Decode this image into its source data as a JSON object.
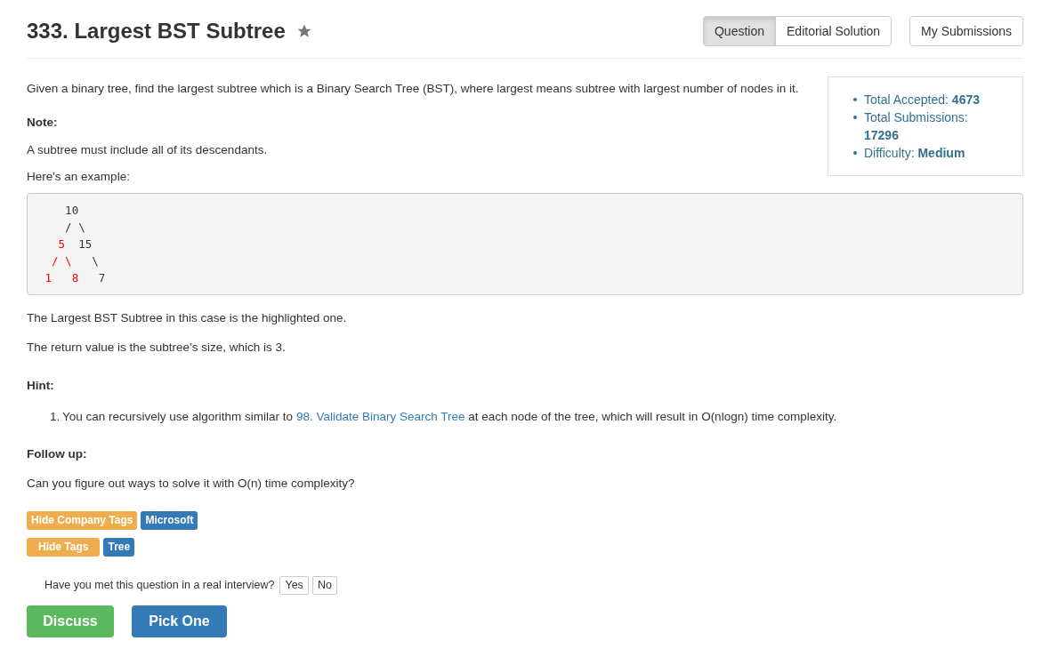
{
  "title": "333. Largest BST Subtree",
  "starred": false,
  "view_tabs": [
    {
      "label": "Question",
      "selected": true
    },
    {
      "label": "Editorial Solution",
      "selected": false
    }
  ],
  "submissions_button": "My Submissions",
  "stats": [
    {
      "label": "Total Accepted:",
      "value": "4673"
    },
    {
      "label": "Total Submissions:",
      "value": "17296"
    },
    {
      "label": "Difficulty:",
      "value": "Medium"
    }
  ],
  "description": "Given a binary tree, find the largest subtree which is a Binary Search Tree (BST), where largest means subtree with largest number of nodes in it.",
  "note_heading": "Note:",
  "note": "A subtree must include all of its descendants.",
  "example_intro": "Here's an example:",
  "example_lines": [
    [
      {
        "text": "    10",
        "highlighted": false
      }
    ],
    [
      {
        "text": "    / \\",
        "highlighted": false
      }
    ],
    [
      {
        "text": "   5",
        "highlighted": true
      },
      {
        "text": "  15",
        "highlighted": false
      }
    ],
    [
      {
        "text": "  / \\",
        "highlighted": true
      },
      {
        "text": "   \\",
        "highlighted": false
      }
    ],
    [
      {
        "text": " 1   8",
        "highlighted": true
      },
      {
        "text": "   7",
        "highlighted": false
      }
    ]
  ],
  "after_example": [
    "The Largest BST Subtree in this case is the highlighted one.",
    "The return value is the subtree's size, which is 3."
  ],
  "hint_heading": "Hint:",
  "hints": [
    {
      "number": "1.",
      "before": "You can recursively use algorithm similar to ",
      "link": "98. Validate Binary Search Tree",
      "after": " at each node of the tree, which will result in O(nlogn) time complexity."
    }
  ],
  "follow_up_heading": "Follow up:",
  "follow_up": "Can you figure out ways to solve it with O(n) time complexity?",
  "tag_rows": [
    {
      "toggle": "Hide Company Tags",
      "tags": [
        "Microsoft"
      ]
    },
    {
      "toggle": "Hide Tags",
      "tags": [
        "Tree"
      ]
    }
  ],
  "interview_question": "Have you met this question in a real interview?",
  "interview_answers": [
    "Yes",
    "No"
  ],
  "discuss_button": "Discuss",
  "pick_button": "Pick One"
}
